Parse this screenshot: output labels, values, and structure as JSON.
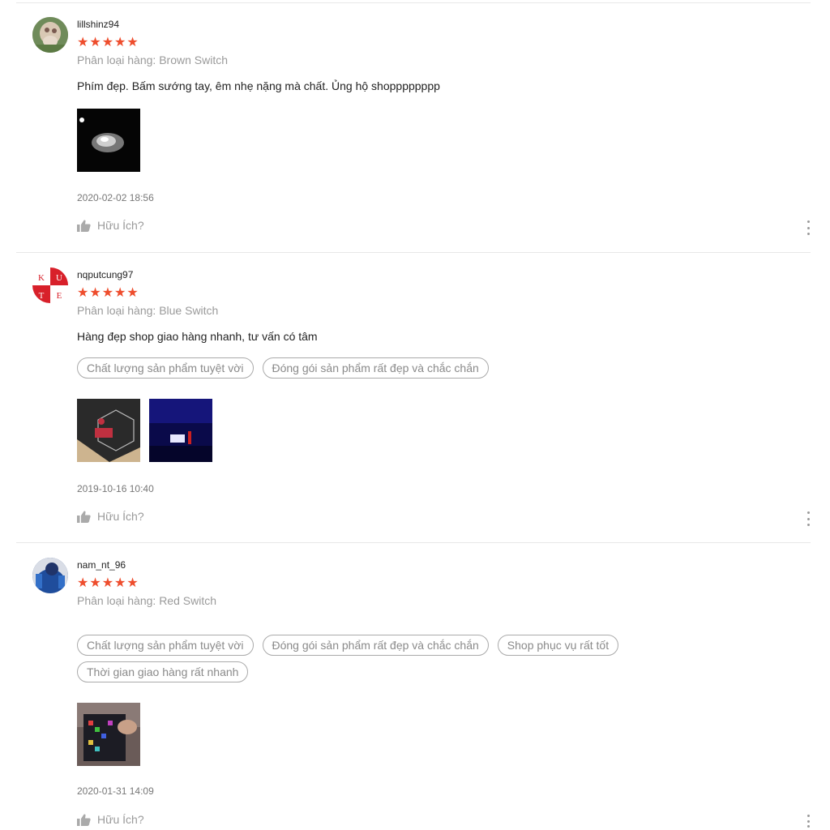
{
  "reviews": [
    {
      "username": "lillshinz94",
      "rating": 5,
      "stars": "★★★★★",
      "variant": "Phân loại hàng: Brown Switch",
      "comment": "Phím đẹp. Bấm sướng tay, êm nhẹ nặng mà chất.  Ủng hộ shopppppppp",
      "tags": [],
      "photo_count": 1,
      "date": "2020-02-02 18:56",
      "helpful_label": "Hữu Ích?"
    },
    {
      "username": "nqputcung97",
      "avatar_letters": [
        "K",
        "U",
        "T",
        "E"
      ],
      "rating": 5,
      "stars": "★★★★★",
      "variant": "Phân loại hàng: Blue Switch",
      "comment": "Hàng đẹp shop giao hàng nhanh, tư vấn có tâm",
      "tags": [
        "Chất lượng sản phẩm tuyệt vời",
        "Đóng gói sản phẩm rất đẹp và chắc chắn"
      ],
      "photo_count": 2,
      "date": "2019-10-16 10:40",
      "helpful_label": "Hữu Ích?"
    },
    {
      "username": "nam_nt_96",
      "rating": 5,
      "stars": "★★★★★",
      "variant": "Phân loại hàng: Red Switch",
      "comment": "",
      "tags": [
        "Chất lượng sản phẩm tuyệt vời",
        "Đóng gói sản phẩm rất đẹp và chắc chắn",
        "Shop phục vụ rất tốt",
        "Thời gian giao hàng rất nhanh"
      ],
      "photo_count": 1,
      "date": "2020-01-31 14:09",
      "helpful_label": "Hữu Ích?"
    }
  ],
  "colors": {
    "star": "#ee4d2d",
    "muted": "#9a9a9a",
    "separator": "#e8e8e8"
  },
  "icons": {
    "helpful": "thumbs-up-icon",
    "more": "more-vertical-icon"
  }
}
